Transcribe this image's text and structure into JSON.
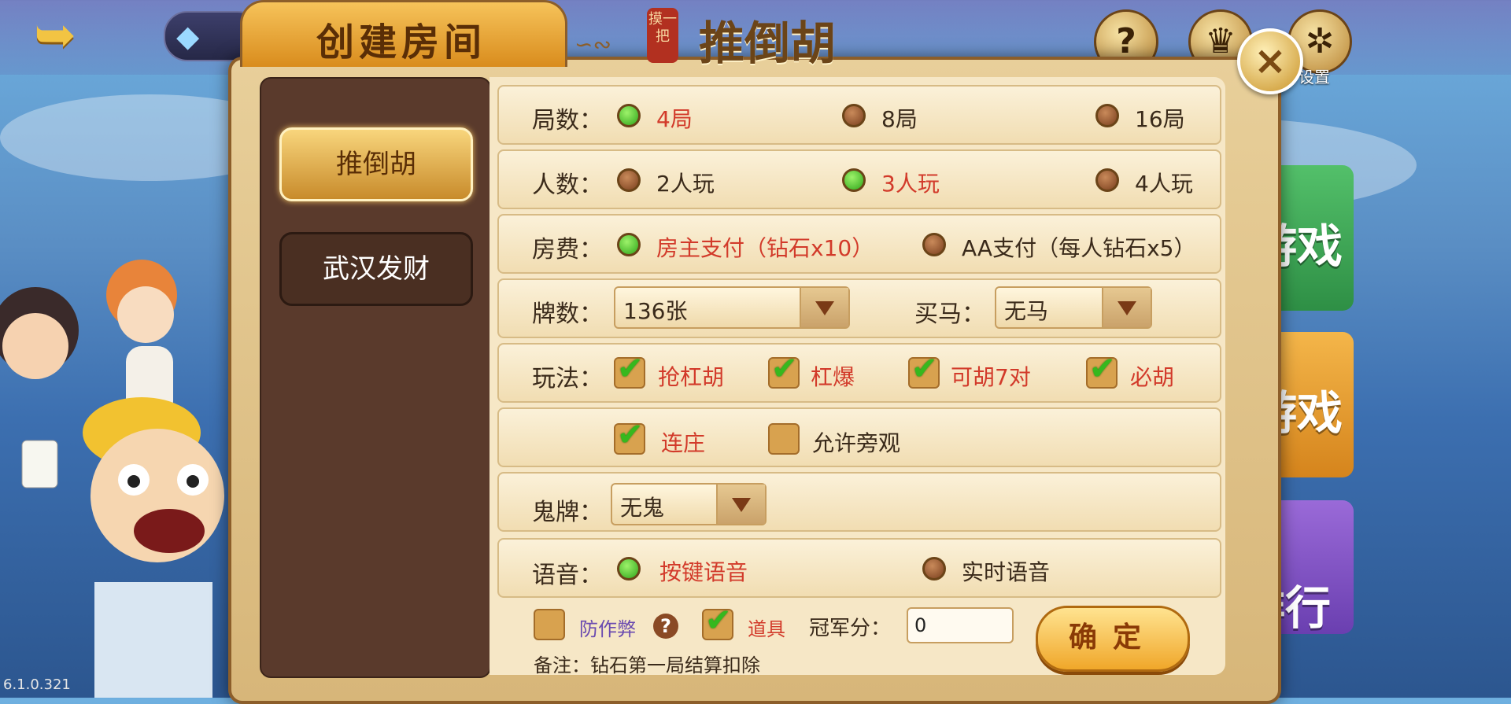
{
  "lobby": {
    "version": "6.1.0.321",
    "settings_label": "设置",
    "tiles": [
      "游戏",
      "游戏",
      "排行榜"
    ]
  },
  "dialog": {
    "title": "创建房间",
    "game_seal": "摸一把",
    "game_name": "推倒胡",
    "close_glyph": "×",
    "tabs": [
      {
        "label": "推倒胡",
        "active": true
      },
      {
        "label": "武汉发财",
        "active": false
      }
    ],
    "rounds": {
      "label": "局数：",
      "options": [
        "4局",
        "8局",
        "16局"
      ],
      "selected": "4局"
    },
    "players": {
      "label": "人数：",
      "options": [
        "2人玩",
        "3人玩",
        "4人玩"
      ],
      "selected": "3人玩"
    },
    "fee": {
      "label": "房费：",
      "options": [
        "房主支付（钻石x10）",
        "AA支付（每人钻石x5）"
      ],
      "selected": "房主支付（钻石x10）"
    },
    "tiles_count": {
      "label": "牌数：",
      "value": "136张"
    },
    "buy_horse": {
      "label": "买马：",
      "value": "无马"
    },
    "rules": {
      "label": "玩法：",
      "options": [
        {
          "label": "抢杠胡",
          "checked": true
        },
        {
          "label": "杠爆",
          "checked": true
        },
        {
          "label": "可胡7对",
          "checked": true
        },
        {
          "label": "必胡",
          "checked": true
        },
        {
          "label": "连庄",
          "checked": true
        },
        {
          "label": "允许旁观",
          "checked": false
        }
      ]
    },
    "ghost": {
      "label": "鬼牌：",
      "value": "无鬼"
    },
    "voice": {
      "label": "语音：",
      "options": [
        "按键语音",
        "实时语音"
      ],
      "selected": "按键语音"
    },
    "anti_cheat": {
      "label": "防作弊",
      "checked": false
    },
    "props": {
      "label": "道具",
      "checked": true
    },
    "champion": {
      "label": "冠军分：",
      "value": "0"
    },
    "confirm_label": "确定",
    "note": "备注：钻石第一局结算扣除"
  },
  "colors": {
    "selected_text": "#d23a2a",
    "radio_on": "#2ea51a",
    "panel_brown": "#5a3a2c"
  }
}
